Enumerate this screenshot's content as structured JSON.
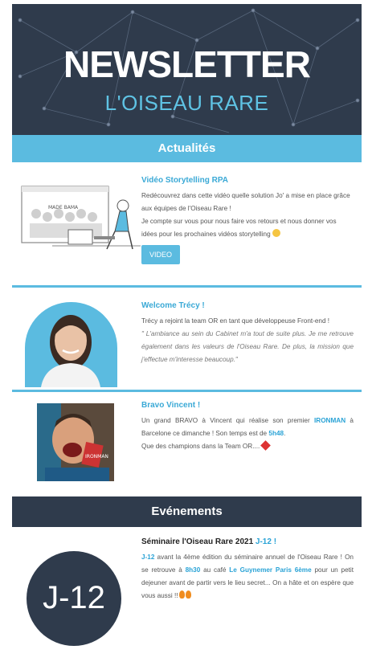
{
  "header": {
    "title": "NEWSLETTER",
    "subtitle": "L'OISEAU RARE"
  },
  "sections": {
    "news_title": "Actualités",
    "events_title": "Evénements"
  },
  "article_video": {
    "title": "Vidéo Storytelling RPA",
    "p1": "Redécouvrez dans cette vidéo quelle solution Jo' a mise en place grâce aux équipes de l'Oiseau Rare !",
    "p2": "Je compte sur vous pour nous faire vos retours et nous donner vos idées pour les  prochaines vidéos storytelling",
    "button": "VIDEO",
    "illus_screen_text": "MADE BAMA"
  },
  "article_welcome": {
    "title": "Welcome Trécy !",
    "p1": "Trécy a rejoint la team OR en tant que développeuse Front-end !",
    "quote": " \" L'ambiance au sein du Cabinet m'a tout de suite plus. Je me retrouve également dans les valeurs de l'Oiseau Rare. De plus, la mission que j'effectue m'interesse beaucoup.\""
  },
  "article_bravo": {
    "title": "Bravo Vincent !",
    "p1_a": "Un grand BRAVO à Vincent qui réalise son premier ",
    "p1_hl": "IRONMAN",
    "p1_b": " à Barcelone ce dimanche ! Son temps est de ",
    "p1_time": "5h48",
    "p1_c": ".",
    "p2": "Que des champions dans la Team OR....",
    "medal_text": "IRONMAN"
  },
  "event": {
    "title_a": "Séminaire l'Oiseau Rare 2021 ",
    "title_hl": "J-12 !",
    "badge": "J-12",
    "t1_hl": "J-12",
    "t1": " avant la 4ème édition du séminaire annuel de l'Oiseau Rare ! On se retrouve à ",
    "t_time": "8h30",
    "t2": " au café ",
    "t_place": "Le Guynemer Paris 6ème",
    "t3": " pour un petit dejeuner avant de partir vers le lieu secret... On a hâte et on espère que vous aussi !!"
  },
  "colors": {
    "dark": "#2f3b4c",
    "accent": "#5bbbe0",
    "link": "#2aa3d6"
  }
}
